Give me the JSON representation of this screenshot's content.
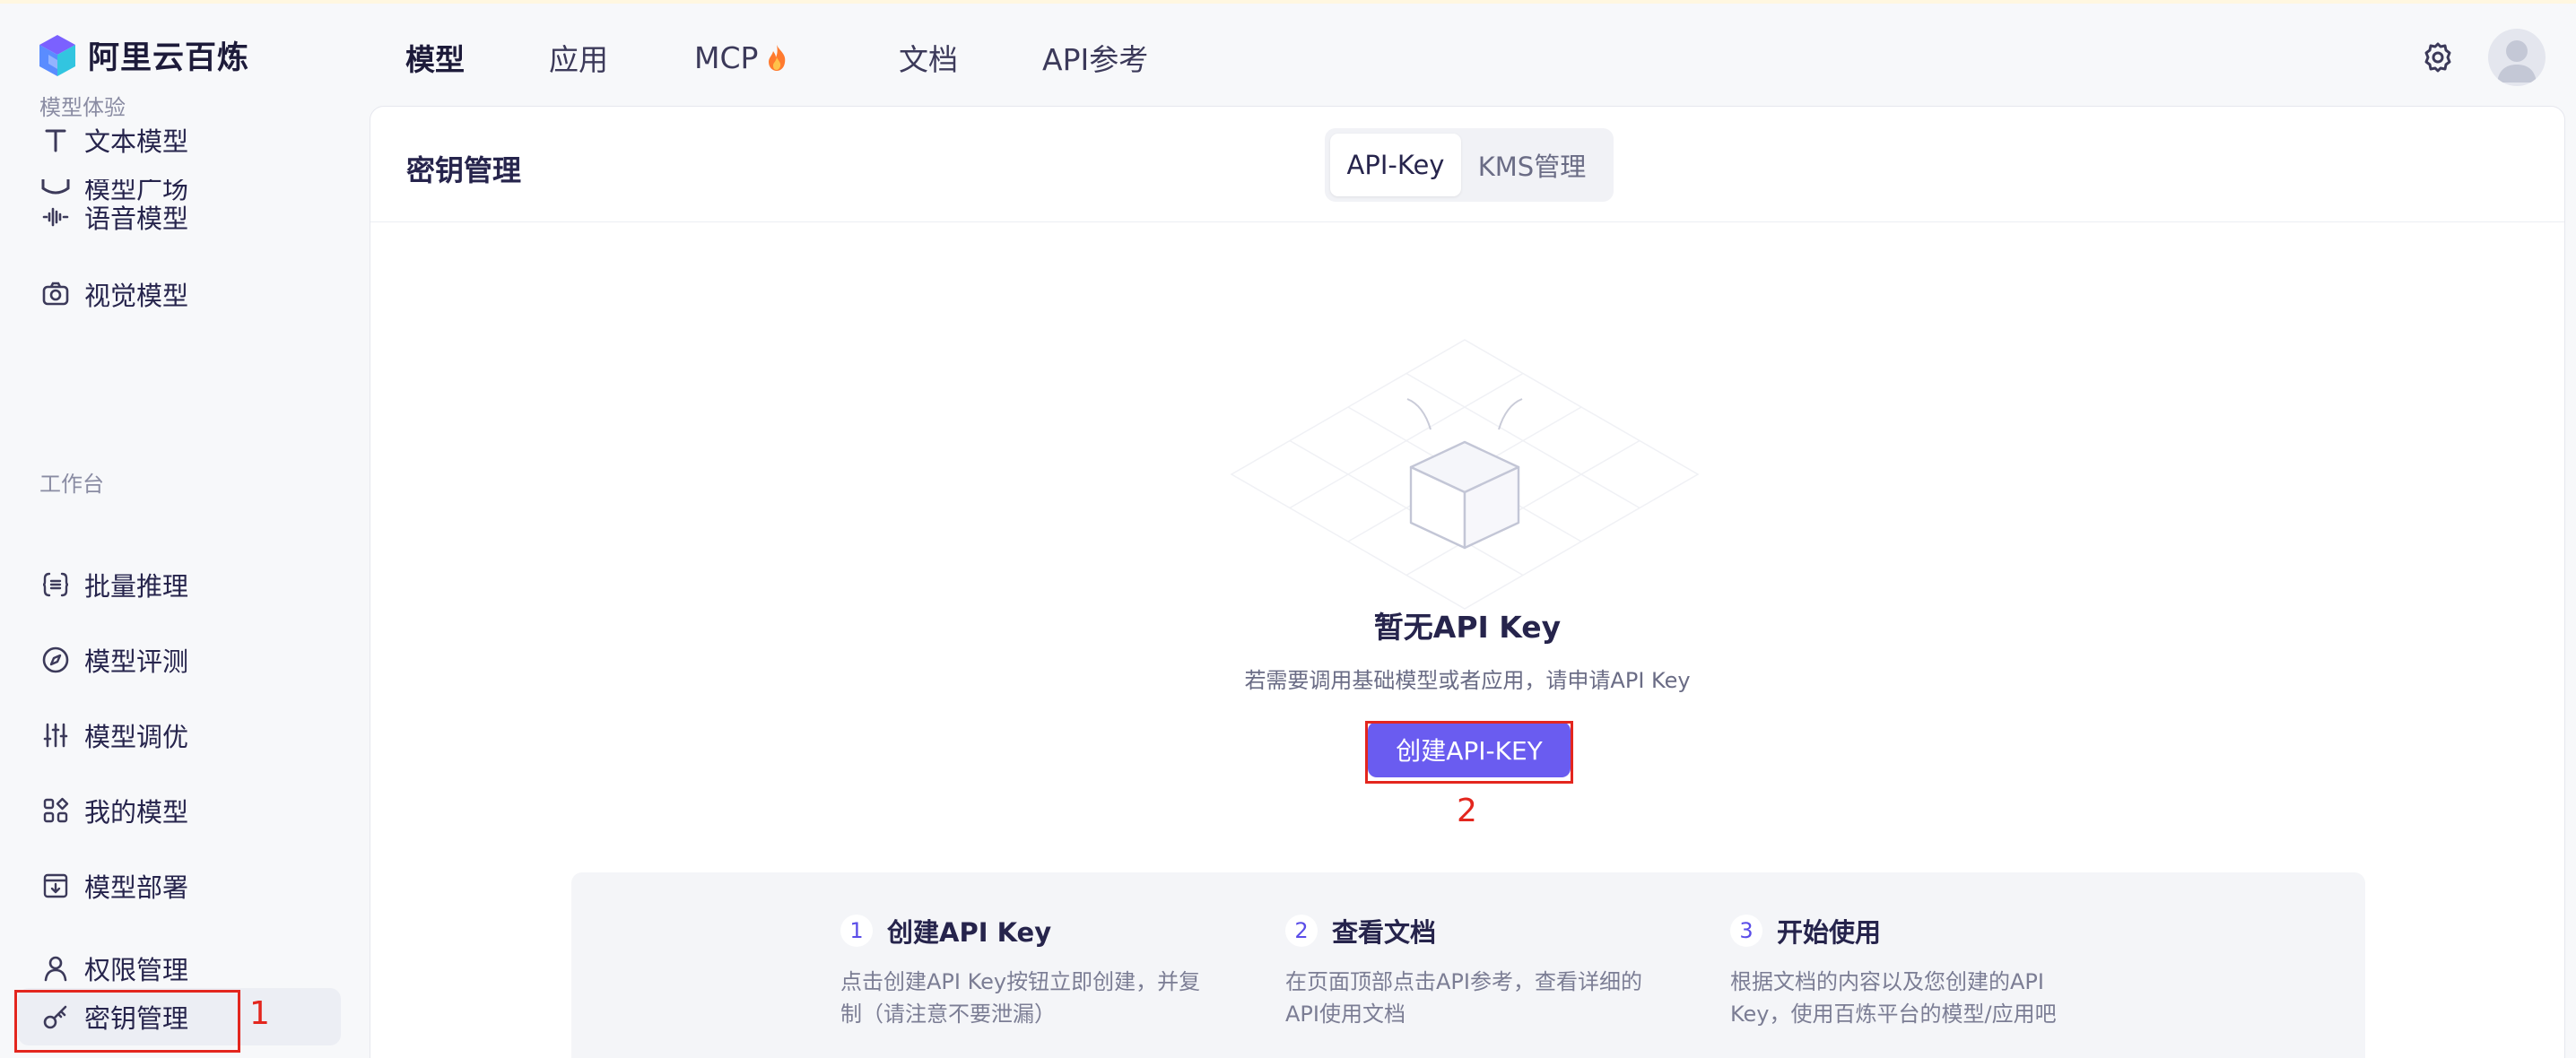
{
  "app": {
    "name": "阿里云百炼"
  },
  "nav": {
    "items": [
      {
        "label": "模型",
        "active": true
      },
      {
        "label": "应用",
        "active": false
      },
      {
        "label": "MCP",
        "active": false,
        "badge_icon": "fire-icon"
      },
      {
        "label": "文档",
        "active": false
      },
      {
        "label": "API参考",
        "active": false
      }
    ]
  },
  "sidebar": {
    "partial_item": "模型广场",
    "section_experience": "模型体验",
    "section_workbench": "工作台",
    "items": [
      {
        "label": "文本模型",
        "icon": "text-icon"
      },
      {
        "label": "语音模型",
        "icon": "waveform-icon"
      },
      {
        "label": "视觉模型",
        "icon": "camera-icon"
      },
      {
        "label": "批量推理",
        "icon": "braces-icon"
      },
      {
        "label": "模型评测",
        "icon": "compass-icon"
      },
      {
        "label": "模型调优",
        "icon": "sliders-icon"
      },
      {
        "label": "我的模型",
        "icon": "grid-icon"
      },
      {
        "label": "模型部署",
        "icon": "deploy-icon"
      },
      {
        "label": "权限管理",
        "icon": "user-icon"
      },
      {
        "label": "密钥管理",
        "icon": "key-icon",
        "active": true
      }
    ]
  },
  "panel": {
    "title": "密钥管理",
    "tabs": [
      {
        "label": "API-Key",
        "active": true
      },
      {
        "label": "KMS管理",
        "active": false
      }
    ],
    "empty": {
      "title": "暂无API Key",
      "description": "若需要调用基础模型或者应用，请申请API Key",
      "button": "创建API-KEY"
    },
    "steps": [
      {
        "num": "1",
        "title": "创建API Key",
        "desc_line1": "点击创建API Key按钮立即创建，并复",
        "desc_line2": "制（请注意不要泄漏）"
      },
      {
        "num": "2",
        "title": "查看文档",
        "desc_line1": "在页面顶部点击API参考，查看详细的",
        "desc_line2": "API使用文档"
      },
      {
        "num": "3",
        "title": "开始使用",
        "desc_line1": "根据文档的内容以及您创建的API",
        "desc_line2": "Key，使用百炼平台的模型/应用吧"
      }
    ]
  },
  "annotations": {
    "marker_1": "1",
    "marker_2": "2",
    "color": "#e3261e"
  },
  "colors": {
    "accent": "#6a5cf0",
    "text_primary": "#26244c",
    "text_secondary": "#6a6c85"
  }
}
